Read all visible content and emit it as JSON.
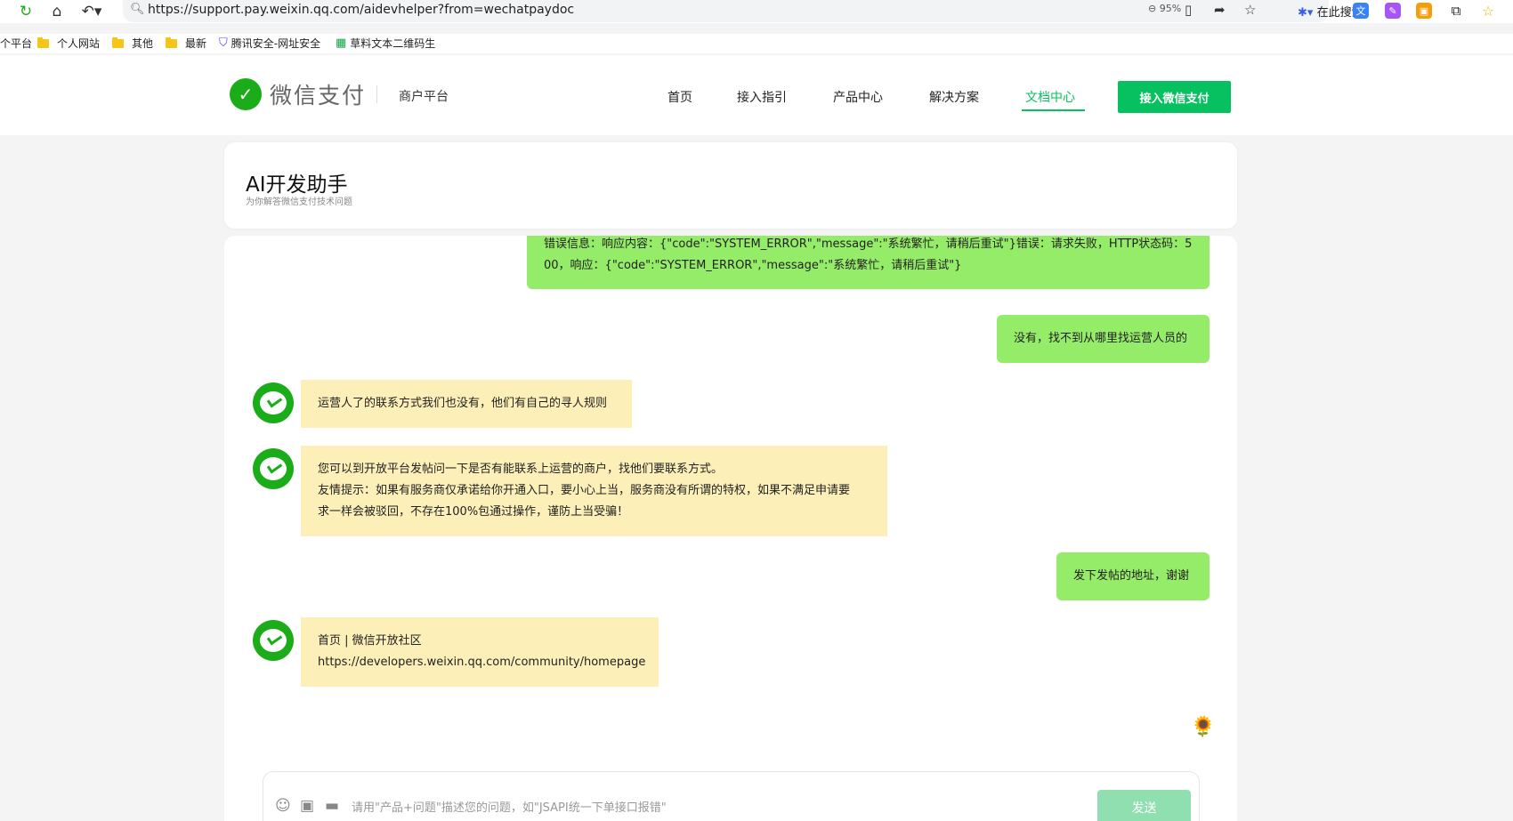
{
  "browser": {
    "url": "https://support.pay.weixin.qq.com/aidevhelper?from=wechatpaydoc",
    "zoom": "95%",
    "search_engine": "在此搜索"
  },
  "bookmarks": [
    "个平台",
    "个人网站",
    "其他",
    "最新",
    "腾讯安全-网址安全",
    "草料文本二维码生"
  ],
  "site": {
    "logo_text": "微信支付",
    "merchant_platform": "商户平台",
    "nav": [
      "首页",
      "接入指引",
      "产品中心",
      "解决方案",
      "文档中心"
    ],
    "active_nav": "文档中心",
    "cta": "接入微信支付"
  },
  "assistant": {
    "title": "AI开发助手",
    "subtitle": "为你解答微信支付技术问题"
  },
  "messages": [
    {
      "role": "user",
      "lines": [
        "错误信息：响应内容：{\"code\":\"SYSTEM_ERROR\",\"message\":\"系统繁忙，请稍后重试\"}错误：请求失败，HTTP状态码：5",
        "00，响应：{\"code\":\"SYSTEM_ERROR\",\"message\":\"系统繁忙，请稍后重试\"}"
      ]
    },
    {
      "role": "user",
      "lines": [
        "没有，找不到从哪里找运营人员的"
      ]
    },
    {
      "role": "bot",
      "lines": [
        "运营人了的联系方式我们也没有，他们有自己的寻人规则"
      ]
    },
    {
      "role": "bot",
      "lines": [
        "您可以到开放平台发帖问一下是否有能联系上运营的商户，找他们要联系方式。",
        "友情提示：如果有服务商仅承诺给你开通入口，要小心上当，服务商没有所谓的特权，如果不满足申请要",
        "求一样会被驳回，不存在100%包通过操作，谨防上当受骗！"
      ]
    },
    {
      "role": "user",
      "lines": [
        "发下发帖的地址，谢谢"
      ]
    },
    {
      "role": "bot",
      "lines": [
        "首页 | 微信开放社区",
        "https://developers.weixin.qq.com/community/homepage"
      ]
    }
  ],
  "input": {
    "placeholder": "请用\"产品+问题\"描述您的问题，如\"JSAPI统一下单接口报错\"",
    "send_label": "发送"
  },
  "colors": {
    "brand_green": "#07c160",
    "user_bubble": "#95ec69",
    "bot_bubble": "#fdefb8",
    "send_disabled": "#8fdfb0"
  }
}
